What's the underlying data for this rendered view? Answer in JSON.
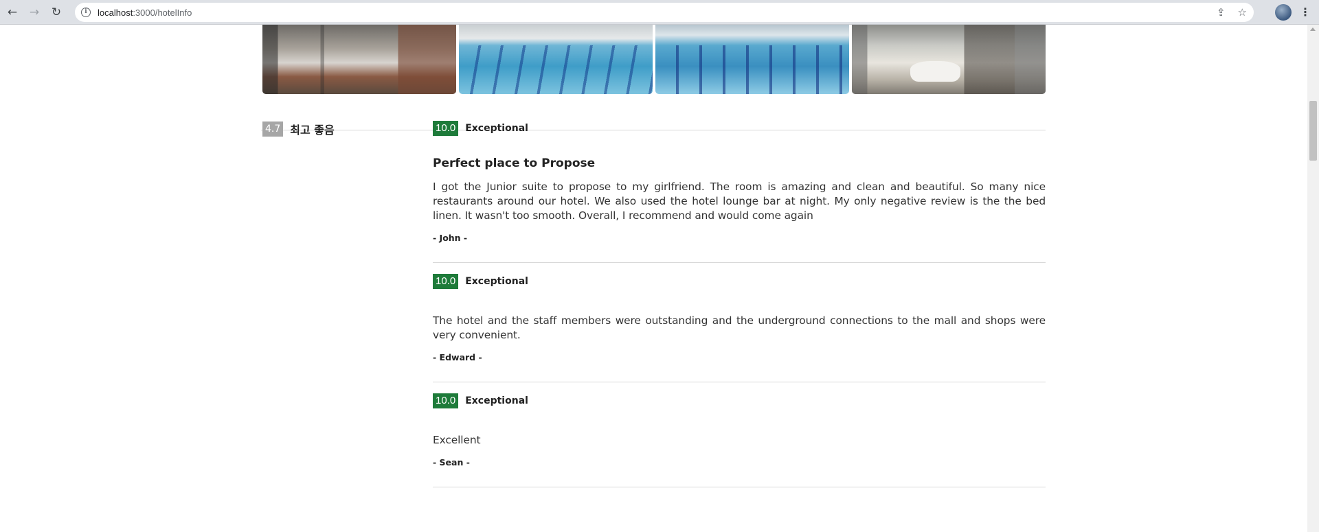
{
  "browser": {
    "url_host": "localhost",
    "url_path": ":3000/hotelInfo",
    "back_icon": "←",
    "forward_icon": "→",
    "reload_icon": "↻",
    "info_icon": "i",
    "share_icon": "⇪",
    "star_icon": "☆",
    "menu_icon": "⋮"
  },
  "gallery": {
    "photos": [
      "lounge-dining-room",
      "indoor-pool-side",
      "indoor-pool-lanes",
      "bathroom-bathtub"
    ]
  },
  "summary": {
    "score": "4.7",
    "label": "최고 좋음",
    "score_color": "#a6a6a6"
  },
  "reviews": [
    {
      "score": "10.0",
      "rating_word": "Exceptional",
      "title": "Perfect place to Propose",
      "body": "I got the Junior suite to propose to my girlfriend. The room is amazing and clean and beautiful. So many nice restaurants around our hotel. We also used the hotel lounge bar at night. My only negative review is the the bed linen. It wasn't too smooth. Overall, I recommend and would come again",
      "author": "- John -"
    },
    {
      "score": "10.0",
      "rating_word": "Exceptional",
      "title": "",
      "body": "The hotel and the staff members were outstanding and the underground connections to the mall and shops were very convenient.",
      "author": "- Edward -"
    },
    {
      "score": "10.0",
      "rating_word": "Exceptional",
      "title": "",
      "body": "Excellent",
      "author": "- Sean -"
    }
  ],
  "colors": {
    "score_badge": "#1e7b3a"
  }
}
